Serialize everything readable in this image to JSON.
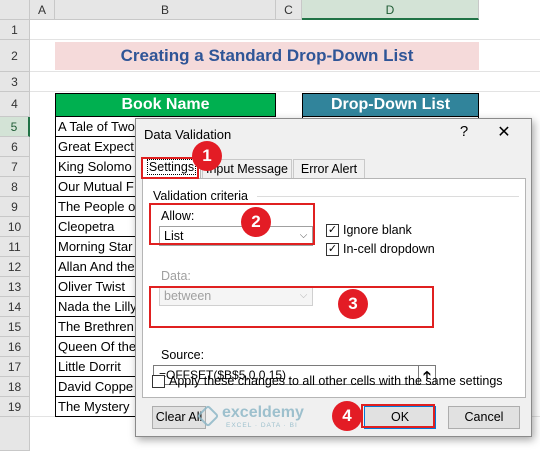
{
  "sheet": {
    "columns": [
      "A",
      "B",
      "C",
      "D"
    ],
    "rows": [
      "1",
      "2",
      "3",
      "4",
      "5",
      "6",
      "7",
      "8",
      "9",
      "10",
      "11",
      "12",
      "13",
      "14",
      "15",
      "16",
      "17",
      "18",
      "19"
    ],
    "title": "Creating a Standard Drop-Down List",
    "header_book": "Book Name",
    "header_dropdown": "Drop-Down List",
    "books": [
      "A Tale of Two",
      "Great Expect",
      "King Solomo",
      "Our Mutual F",
      "The People o",
      "Cleopetra",
      "Morning Star",
      "Allan And the",
      "Oliver Twist",
      "Nada the Lilly",
      "The Brethren",
      "Queen Of the",
      "Little Dorrit",
      "David Coppe",
      "The Mystery"
    ],
    "colors": {
      "title_bg": "#f5dada",
      "title_text": "#2f5597",
      "book_header_bg": "#00b050",
      "dropdown_header_bg": "#31849b",
      "selection": "#217346"
    }
  },
  "dialog": {
    "title": "Data Validation",
    "help_glyph": "?",
    "close_glyph": "✕",
    "tabs": [
      {
        "label": "Settings"
      },
      {
        "label": "Input Message"
      },
      {
        "label": "Error Alert"
      }
    ],
    "validation_criteria_label": "Validation criteria",
    "allow_label": "Allow:",
    "allow_value": "List",
    "ignore_blank_label": "Ignore blank",
    "ignore_blank_checked": true,
    "in_cell_dropdown_label": "In-cell dropdown",
    "in_cell_dropdown_checked": true,
    "data_label": "Data:",
    "data_value": "between",
    "source_label": "Source:",
    "source_value": "=OFFSET($B$5,0,0,15)",
    "apply_all_label": "Apply these changes to all other cells with the same settings",
    "apply_all_checked": false,
    "clear_all_label": "Clear All",
    "ok_label": "OK",
    "cancel_label": "Cancel"
  },
  "annotations": {
    "step1": "1",
    "step2": "2",
    "step3": "3",
    "step4": "4",
    "color": "#e31c25"
  },
  "watermark": {
    "brand": "exceldemy",
    "tagline": "EXCEL · DATA · BI"
  }
}
